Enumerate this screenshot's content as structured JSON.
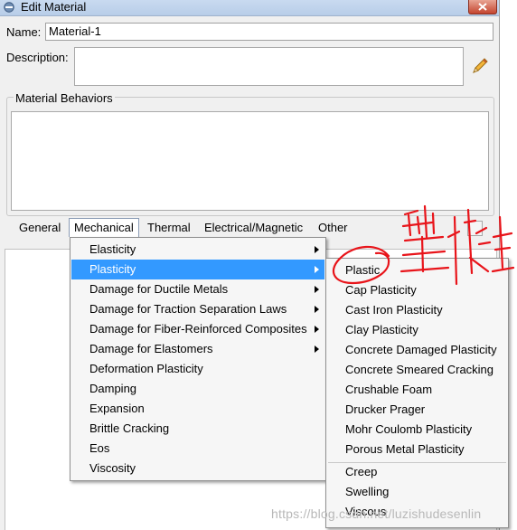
{
  "window": {
    "title": "Edit Material"
  },
  "form": {
    "name_label": "Name:",
    "name_value": "Material-1",
    "description_label": "Description:",
    "description_value": ""
  },
  "behaviors": {
    "group_label": "Material Behaviors"
  },
  "menubar": {
    "items": [
      "General",
      "Mechanical",
      "Thermal",
      "Electrical/Magnetic",
      "Other"
    ],
    "active": "Mechanical"
  },
  "mechanical_menu": {
    "items": [
      {
        "label": "Elasticity",
        "submenu": true
      },
      {
        "label": "Plasticity",
        "submenu": true,
        "highlighted": true
      },
      {
        "label": "Damage for Ductile Metals",
        "submenu": true
      },
      {
        "label": "Damage for Traction Separation Laws",
        "submenu": true
      },
      {
        "label": "Damage for Fiber-Reinforced Composites",
        "submenu": true
      },
      {
        "label": "Damage for Elastomers",
        "submenu": true
      },
      {
        "label": "Deformation Plasticity",
        "submenu": false
      },
      {
        "label": "Damping",
        "submenu": false
      },
      {
        "label": "Expansion",
        "submenu": false
      },
      {
        "label": "Brittle Cracking",
        "submenu": false
      },
      {
        "label": "Eos",
        "submenu": false
      },
      {
        "label": "Viscosity",
        "submenu": false
      }
    ]
  },
  "plasticity_submenu": {
    "items_group1": [
      "Plastic",
      "Cap Plasticity",
      "Cast Iron Plasticity",
      "Clay Plasticity",
      "Concrete Damaged Plasticity",
      "Concrete Smeared Cracking",
      "Crushable Foam",
      "Drucker Prager",
      "Mohr Coulomb Plasticity",
      "Porous Metal Plasticity"
    ],
    "items_group2": [
      "Creep",
      "Swelling",
      "Viscous"
    ]
  },
  "watermark": "https://blog.csdn.net/luzishudesenlin",
  "colors": {
    "highlight": "#3399ff",
    "annotation": "#e8141a"
  },
  "icons": {
    "edit": "pencil-icon",
    "window": "window-menu-icon",
    "close": "close-icon"
  }
}
